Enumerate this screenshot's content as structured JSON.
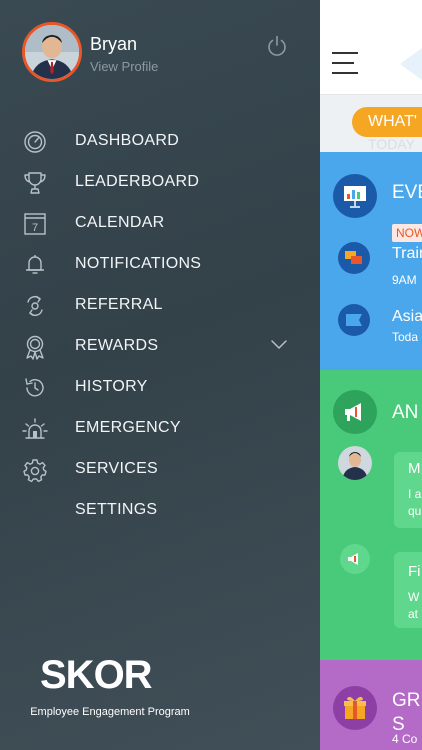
{
  "profile": {
    "name": "Bryan",
    "view_profile": "View Profile"
  },
  "menu": [
    {
      "label": "DASHBOARD",
      "icon": "dashboard-icon"
    },
    {
      "label": "LEADERBOARD",
      "icon": "trophy-icon"
    },
    {
      "label": "CALENDAR",
      "icon": "calendar-icon",
      "day": "7"
    },
    {
      "label": "NOTIFICATIONS",
      "icon": "bell-icon"
    },
    {
      "label": "REFERRAL",
      "icon": "referral-icon"
    },
    {
      "label": "REWARDS",
      "icon": "rewards-icon",
      "expandable": true
    },
    {
      "label": "HISTORY",
      "icon": "history-icon"
    },
    {
      "label": "EMERGENCY",
      "icon": "emergency-icon"
    },
    {
      "label": "SERVICES",
      "icon": "gear-icon"
    },
    {
      "label": "SETTINGS",
      "icon": ""
    }
  ],
  "brand": {
    "logo_text": "SKOR",
    "tagline": "Employee Engagement Program"
  },
  "content": {
    "whats_pill": "WHAT'",
    "today": "TODAY",
    "events": {
      "title": "EVE",
      "now_badge": "NOW",
      "item1_title": "Train",
      "item1_time": "9AM",
      "item2_title": "Asia",
      "item2_sub": "Toda"
    },
    "announcements": {
      "title": "AN",
      "msg1_title": "M",
      "msg1_line1": "I a",
      "msg1_line2": "qu",
      "msg2_title": "Fi",
      "msg2_line1": "W",
      "msg2_line2": "at"
    },
    "groups": {
      "title_line1": "GR",
      "title_line2": "S",
      "sub": "4 Co"
    }
  },
  "colors": {
    "drawer_bg": "#36454d",
    "avatar_ring": "#e8572a",
    "events": "#4aa7ec",
    "announcements": "#49c97a",
    "groups": "#b46ac7",
    "whats_pill": "#f5a623"
  }
}
